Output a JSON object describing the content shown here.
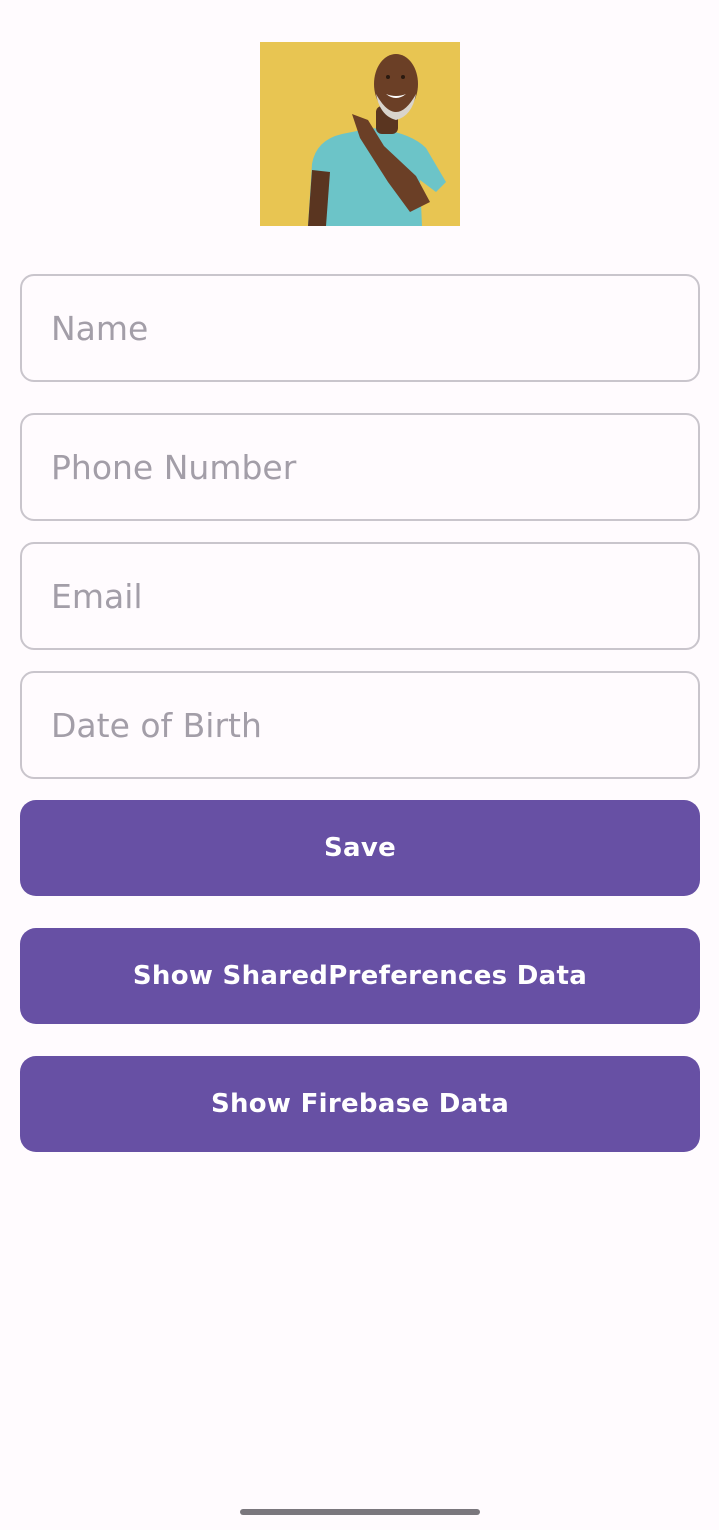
{
  "form": {
    "name_placeholder": "Name",
    "phone_placeholder": "Phone Number",
    "email_placeholder": "Email",
    "dob_placeholder": "Date of Birth"
  },
  "buttons": {
    "save_label": "Save",
    "show_shared_prefs_label": "Show SharedPreferences Data",
    "show_firebase_label": "Show Firebase Data"
  },
  "colors": {
    "background": "#fffbfe",
    "button_primary": "#6750a4",
    "button_text": "#ffffff",
    "field_border": "#c9c5cc",
    "placeholder_text": "#a39ea8",
    "photo_background": "#e8c552"
  },
  "icons": {
    "profile_photo": "profile-photo"
  }
}
